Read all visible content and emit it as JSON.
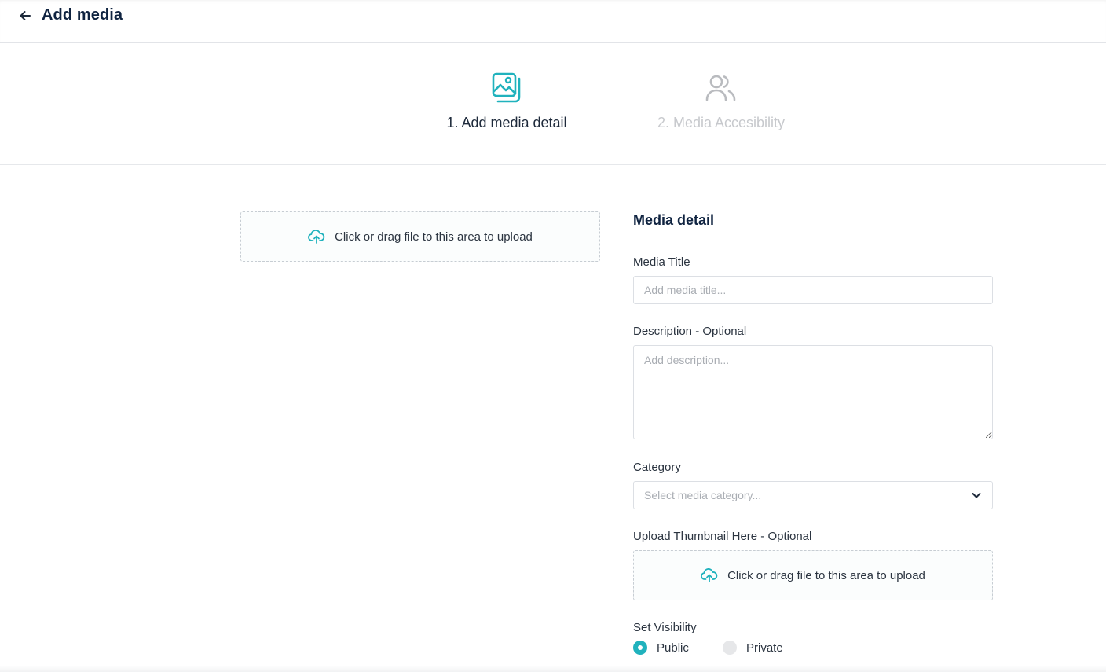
{
  "header": {
    "title": "Add media",
    "back_icon": "arrow-left-icon"
  },
  "stepper": {
    "steps": [
      {
        "label": "1. Add media detail",
        "icon": "image-gallery-icon",
        "state": "active"
      },
      {
        "label": "2. Media Accesibility",
        "icon": "users-icon",
        "state": "inactive"
      }
    ]
  },
  "upload": {
    "text": "Click or drag file to this area to upload",
    "icon": "cloud-upload-icon"
  },
  "form": {
    "section_title": "Media detail",
    "title_label": "Media Title",
    "title_placeholder": "Add media title...",
    "description_label": "Description - Optional",
    "description_placeholder": "Add description...",
    "category_label": "Category",
    "category_placeholder": "Select media category...",
    "thumbnail_label": "Upload Thumbnail Here - Optional",
    "thumbnail_upload_text": "Click or drag file to this area to upload",
    "visibility_label": "Set Visibility",
    "visibility_options": [
      {
        "label": "Public",
        "selected": true
      },
      {
        "label": "Private",
        "selected": false
      }
    ]
  },
  "colors": {
    "accent": "#20b2bd",
    "title": "#0f2340",
    "inactive": "#c7c9cd"
  }
}
